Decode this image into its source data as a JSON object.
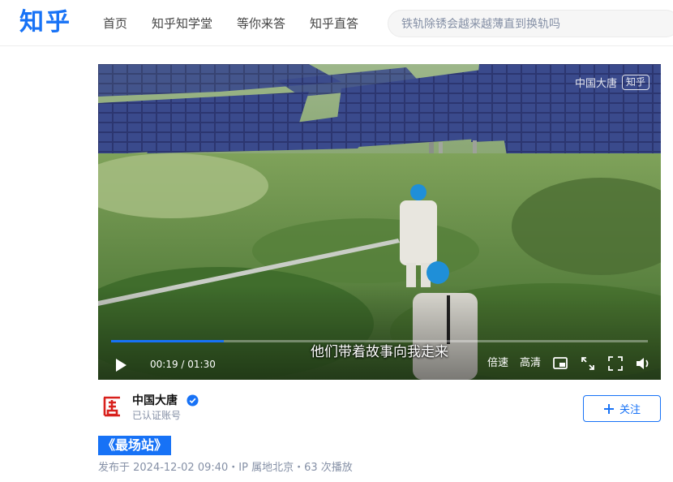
{
  "header": {
    "logo": "知乎",
    "nav": [
      "首页",
      "知乎知学堂",
      "等你来答",
      "知乎直答"
    ],
    "search_placeholder": "铁轨除锈会越来越薄直到换轨吗"
  },
  "video": {
    "watermark": "中国大唐",
    "watermark_badge": "知乎",
    "subtitle": "他们带着故事向我走来",
    "current_time": "00:19",
    "duration": "01:30",
    "time_display": "00:19 / 01:30",
    "progress_fraction": 0.21,
    "speed_label": "倍速",
    "quality_label": "高清",
    "icons": [
      "play-icon",
      "picture-in-picture-icon",
      "web-fullscreen-icon",
      "fullscreen-icon",
      "volume-icon"
    ]
  },
  "author": {
    "name": "中国大唐",
    "subtitle": "已认证账号",
    "follow_label": "关注",
    "avatar_color": "#d8201c",
    "verified_color": "#1772f6"
  },
  "post": {
    "title": "《最场站》",
    "meta": "发布于 2024-12-02 09:40・IP 属地北京・63 次播放"
  },
  "colors": {
    "brand": "#1772f6",
    "muted": "#8590a6"
  }
}
